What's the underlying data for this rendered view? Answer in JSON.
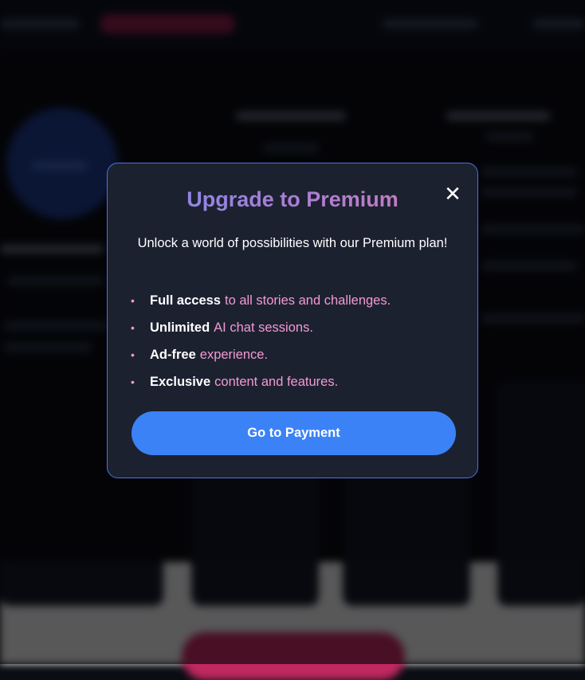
{
  "modal": {
    "title": "Upgrade to Premium",
    "close_icon": "close-icon",
    "close_glyph": "✕",
    "subtitle": "Unlock a world of possibilities with our Premium plan!",
    "benefits": [
      {
        "strong": "Full access",
        "rest": "to all stories and challenges."
      },
      {
        "strong": "Unlimited",
        "rest": "AI chat sessions."
      },
      {
        "strong": "Ad-free",
        "rest": "experience."
      },
      {
        "strong": "Exclusive",
        "rest": "content and features."
      }
    ],
    "bullet_glyph": "•",
    "payment_button_label": "Go to Payment"
  },
  "colors": {
    "modal_background": "#1c2130",
    "modal_border": "#4b74e0",
    "title_gradient_start": "#7b8bf0",
    "title_gradient_end": "#d27ab6",
    "benefit_accent": "#f39ad3",
    "primary_button": "#3b82f6"
  }
}
